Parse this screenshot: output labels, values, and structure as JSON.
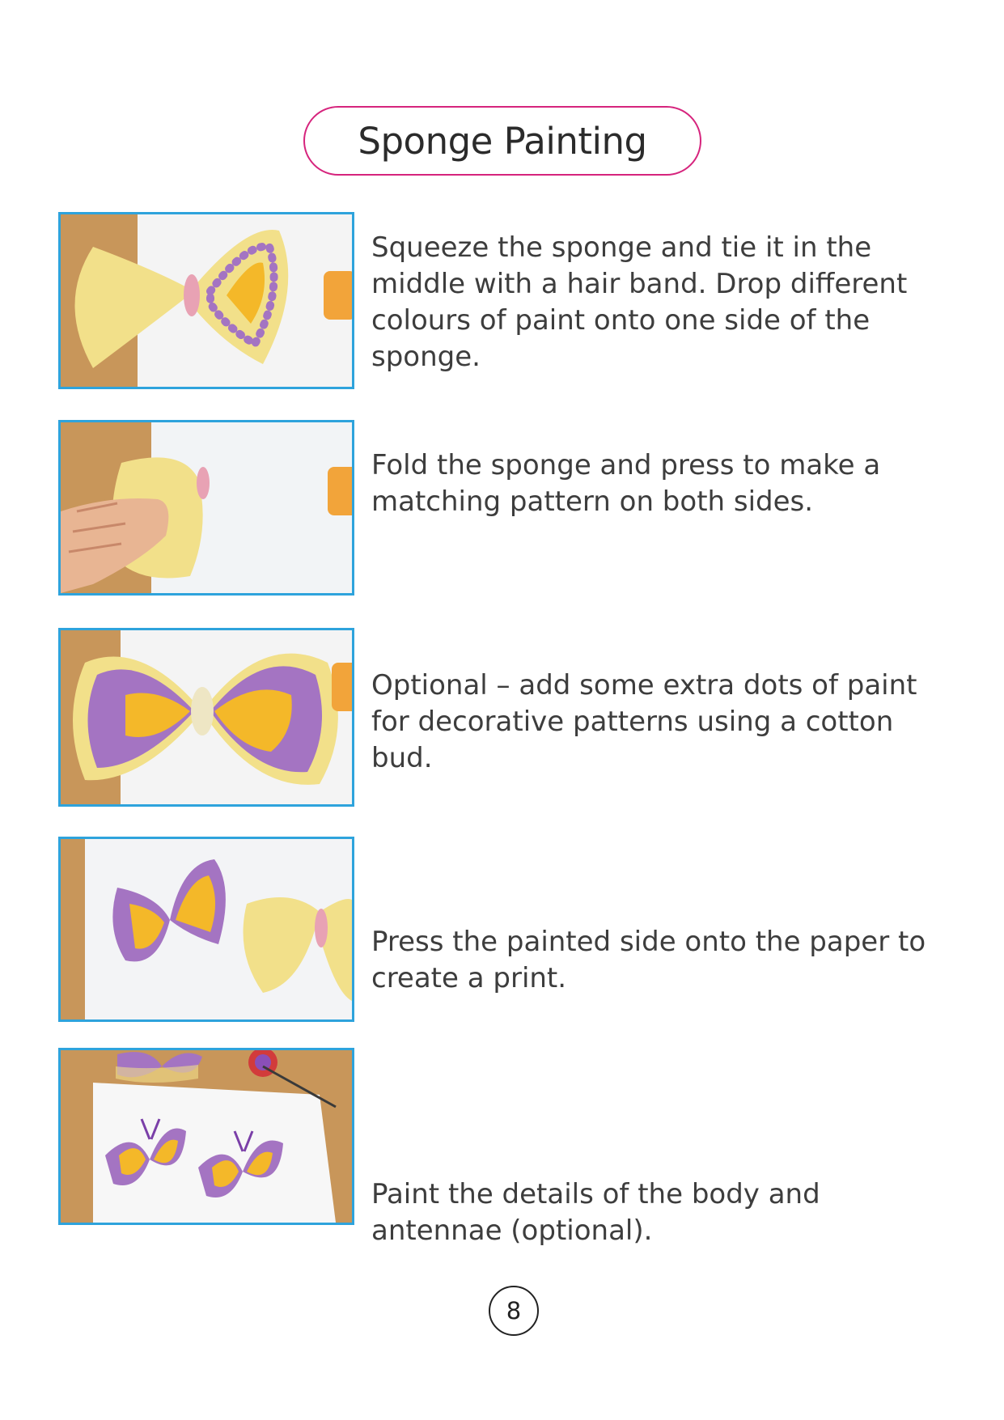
{
  "title": "Sponge Painting",
  "steps": [
    {
      "text": "Squeeze the sponge and tie it in the middle with a hair band. Drop different colours of paint onto one side of the sponge."
    },
    {
      "text": "Fold the sponge and press to make a matching pattern on both sides."
    },
    {
      "text": "Optional – add some extra dots of paint for decorative patterns using a cotton bud."
    },
    {
      "text": "Press the painted side onto the paper to create a print."
    },
    {
      "text": "Paint the details of the body and antennae (optional)."
    }
  ],
  "page_number": "8",
  "colors": {
    "title_border": "#d6247d",
    "photo_border": "#2ea3dc",
    "sponge": "#f2e08a",
    "purple_paint": "#a474c2",
    "yellow_paint": "#f4b829",
    "wood": "#c8965a"
  }
}
